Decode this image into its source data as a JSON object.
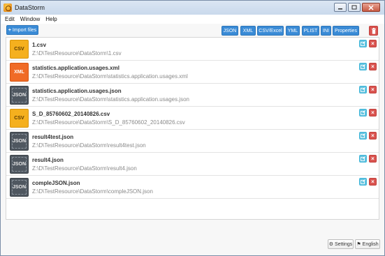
{
  "window": {
    "title": "DataStorm"
  },
  "menu": [
    "Edit",
    "Window",
    "Help"
  ],
  "toolbar": {
    "import_label": "Import files",
    "formats": [
      "JSON",
      "XML",
      "CSV/Excel",
      "YML",
      "PLIST",
      "INI",
      "Properties"
    ]
  },
  "files": [
    {
      "type": "CSV",
      "name": "1.csv",
      "path": "Z:\\D\\TestResource\\DataStorm\\1.csv"
    },
    {
      "type": "XML",
      "name": "statistics.application.usages.xml",
      "path": "Z:\\D\\TestResource\\DataStorm\\statistics.application.usages.xml"
    },
    {
      "type": "JSON",
      "name": "statistics.application.usages.json",
      "path": "Z:\\D\\TestResource\\DataStorm\\statistics.application.usages.json"
    },
    {
      "type": "CSV",
      "name": "S_D_85760602_20140826.csv",
      "path": "Z:\\D\\TestResource\\DataStorm\\S_D_85760602_20140826.csv"
    },
    {
      "type": "JSON",
      "name": "result4test.json",
      "path": "Z:\\D\\TestResource\\DataStorm\\result4test.json"
    },
    {
      "type": "JSON",
      "name": "result4.json",
      "path": "Z:\\D\\TestResource\\DataStorm\\result4.json"
    },
    {
      "type": "JSON",
      "name": "compleJSON.json",
      "path": "Z:\\D\\TestResource\\DataStorm\\compleJSON.json"
    }
  ],
  "footer": {
    "settings_label": "Settings",
    "language_label": "English"
  },
  "colors": {
    "primary": "#3a8bd6",
    "danger": "#d9534f",
    "info": "#5bc0de",
    "csv": "#f5b01e",
    "xml": "#f06b26",
    "json": "#4f5760"
  }
}
